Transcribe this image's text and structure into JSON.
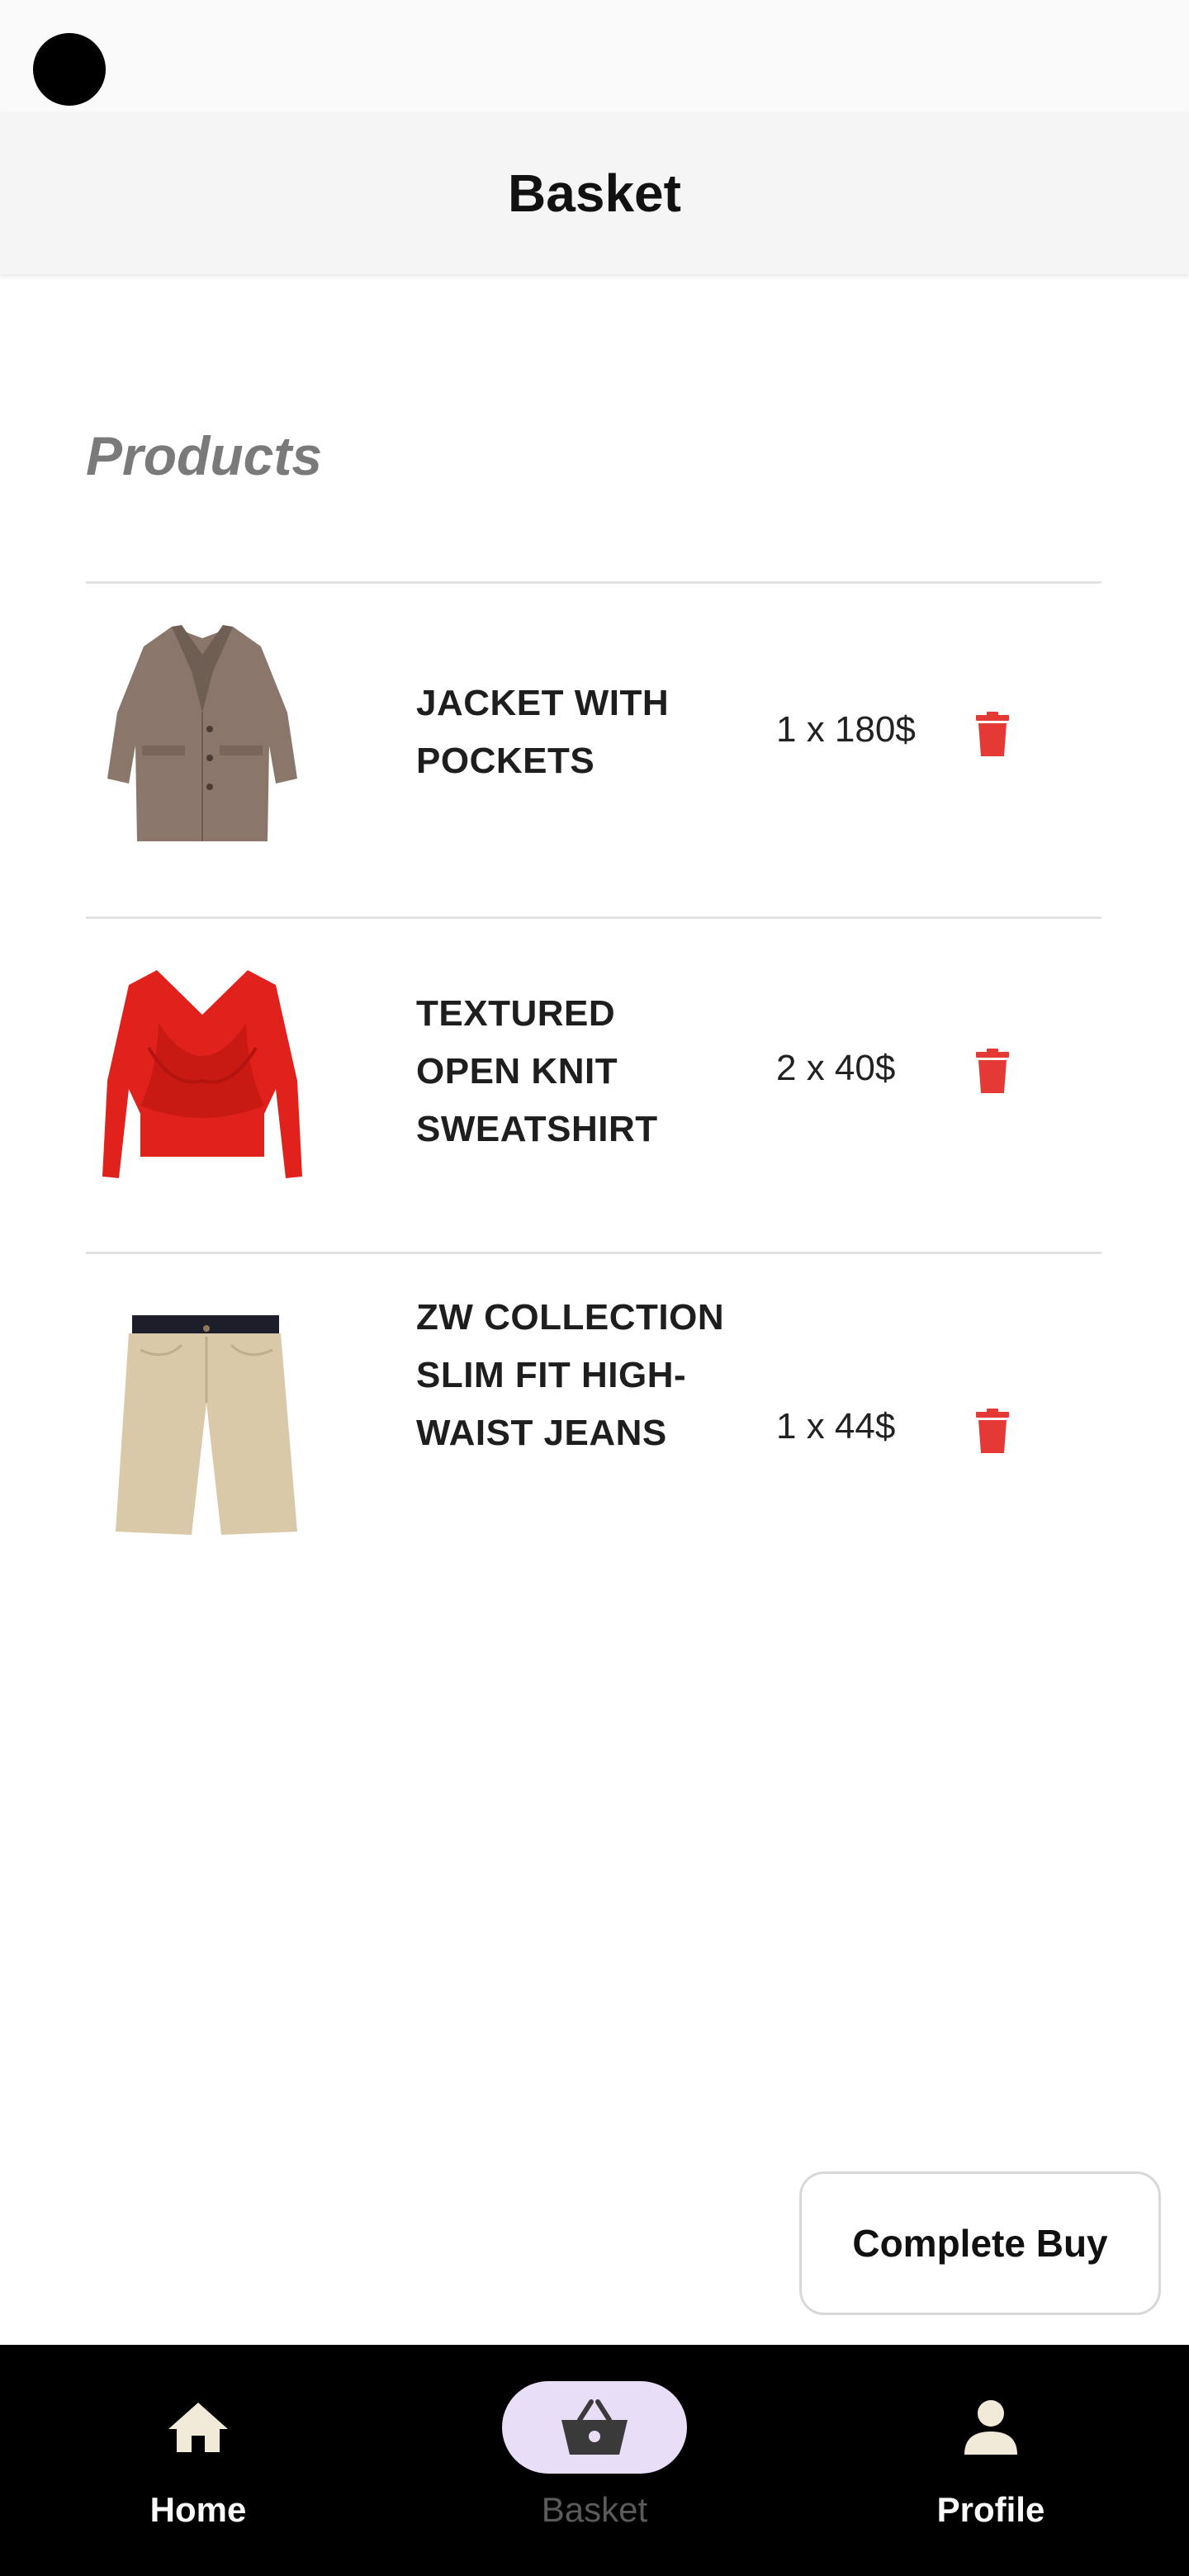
{
  "app_bar": {
    "title": "Basket"
  },
  "section": {
    "title": "Products"
  },
  "products": [
    {
      "name": "JACKET WITH POCKETS",
      "quantity_price": "1 x 180$"
    },
    {
      "name": "TEXTURED OPEN KNIT SWEATSHIRT",
      "quantity_price": "2 x 40$"
    },
    {
      "name": "ZW COLLECTION SLIM FIT HIGH-WAIST JEANS",
      "quantity_price": "1 x 44$"
    }
  ],
  "actions": {
    "complete_buy_label": "Complete Buy"
  },
  "bottom_nav": {
    "items": [
      {
        "label": "Home",
        "icon": "home-icon"
      },
      {
        "label": "Basket",
        "icon": "basket-icon",
        "active": true
      },
      {
        "label": "Profile",
        "icon": "person-icon"
      }
    ]
  },
  "colors": {
    "delete_icon": "#e53935",
    "nav_background": "#000000",
    "active_pill": "#e9def8",
    "nav_icon": "#f2ead8"
  }
}
